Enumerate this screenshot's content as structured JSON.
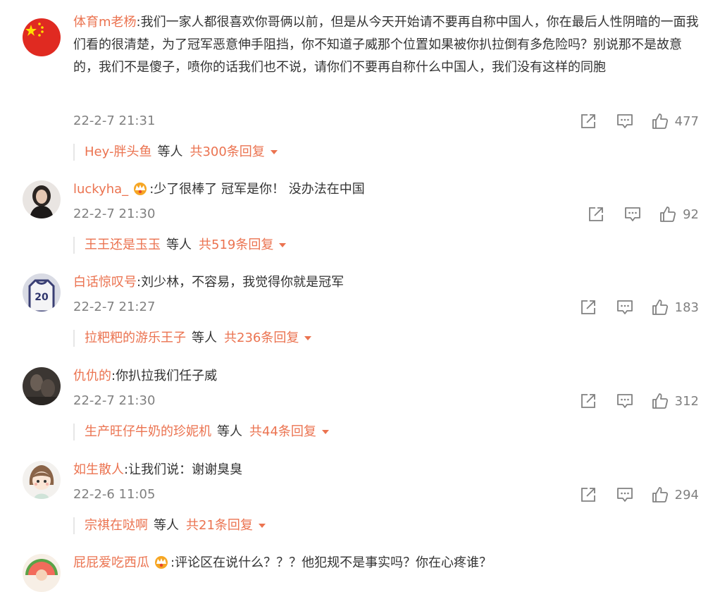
{
  "colors": {
    "accent": "#eb7350",
    "text": "#333333",
    "meta": "#808080"
  },
  "comments": [
    {
      "user": "体育m老杨",
      "content": ":我们一家人都很喜欢你哥俩以前，但是从今天开始请不要再自称中国人，你在最后人性阴暗的一面我们看的很清楚，为了冠军恶意伸手阻挡，你不知道子威那个位置如果被你扒拉倒有多危险吗？别说那不是故意的，我们不是傻子，喷你的话我们也不说，请你们不要再自称什么中国人，我们没有这样的同胞",
      "time": "22-2-7 21:31",
      "likes": "477",
      "reply_user": "Hey-胖头鱼",
      "reply_deng": "等人",
      "reply_total": "共300条回复",
      "crown": false,
      "avatar_icon": "flag-avatar"
    },
    {
      "user": "luckyha_",
      "content": ":少了很棒了 冠军是你！ 没办法在中国",
      "time": "22-2-7 21:30",
      "likes": "92",
      "reply_user": "王王还是玉玉",
      "reply_deng": "等人",
      "reply_total": "共519条回复",
      "crown": true,
      "avatar_icon": "portrait-avatar"
    },
    {
      "user": "白话惊叹号",
      "content": ":刘少林，不容易，我觉得你就是冠军",
      "time": "22-2-7 21:27",
      "likes": "183",
      "reply_user": "拉粑粑的游乐王子",
      "reply_deng": "等人",
      "reply_total": "共236条回复",
      "crown": false,
      "avatar_icon": "jersey-avatar",
      "avatar_number": "20"
    },
    {
      "user": "仇仇的",
      "content": ":你扒拉我们任子威",
      "time": "22-2-7 21:30",
      "likes": "312",
      "reply_user": "生产旺仔牛奶的珍妮机",
      "reply_deng": "等人",
      "reply_total": "共44条回复",
      "crown": false,
      "avatar_icon": "dark-photo-avatar"
    },
    {
      "user": "如生散人",
      "content": ":让我们说：谢谢臭臭",
      "time": "22-2-6 11:05",
      "likes": "294",
      "reply_user": "宗祺在哒啊",
      "reply_deng": "等人",
      "reply_total": "共21条回复",
      "crown": false,
      "avatar_icon": "cartoon-girl-avatar"
    },
    {
      "user": "屁屁爱吃西瓜",
      "content": ":评论区在说什么？？？他犯规不是事实吗？你在心疼谁？",
      "crown": true,
      "avatar_icon": "watermelon-avatar"
    }
  ],
  "icons": {
    "share": "share-icon",
    "reply": "comment-icon",
    "like": "thumbs-up-icon",
    "vip": "crown-icon",
    "expand": "caret-down-icon"
  }
}
